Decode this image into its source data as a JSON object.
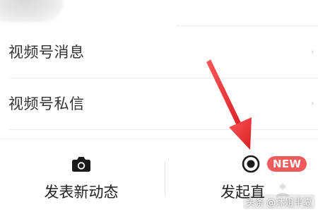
{
  "list": {
    "items": [
      {
        "label": "视频号消息"
      },
      {
        "label": "视频号私信"
      }
    ]
  },
  "actions": {
    "post": {
      "label": "发表新动态",
      "icon": "camera-icon"
    },
    "live": {
      "label": "发起直",
      "icon": "live-record-icon",
      "badge": "NEW"
    }
  },
  "watermark": {
    "prefix": "头条",
    "text": "@沐姐半夏"
  },
  "colors": {
    "badge": "#f15b5b",
    "arrow": "#e8262b",
    "text": "#333333"
  }
}
